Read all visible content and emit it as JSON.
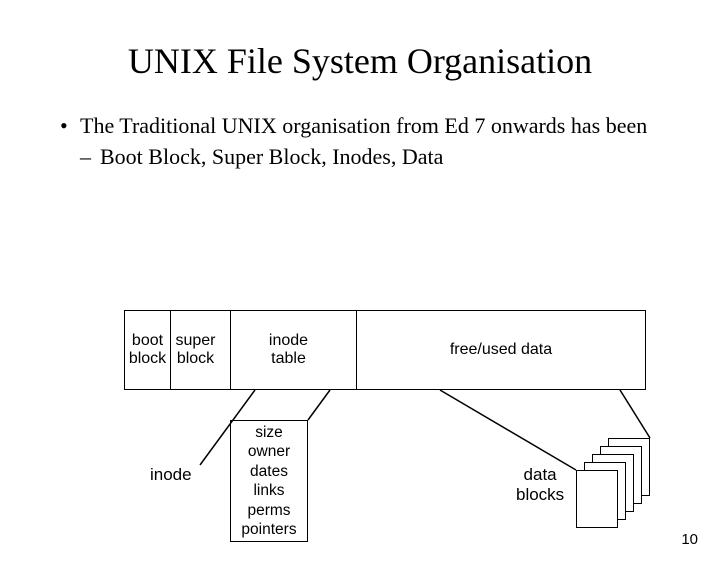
{
  "title": "UNIX File System Organisation",
  "bullets": {
    "main": "The Traditional UNIX organisation from Ed 7 onwards has been",
    "sub": "Boot Block, Super Block, Inodes, Data"
  },
  "blocks": {
    "boot": "boot block",
    "super": "super block",
    "inode_table": "inode table",
    "free_used": "free/used data"
  },
  "inode": {
    "label": "inode",
    "fields": [
      "size",
      "owner",
      "dates",
      "links",
      "perms",
      "pointers"
    ]
  },
  "data_blocks_label": "data blocks",
  "page_number": "10"
}
